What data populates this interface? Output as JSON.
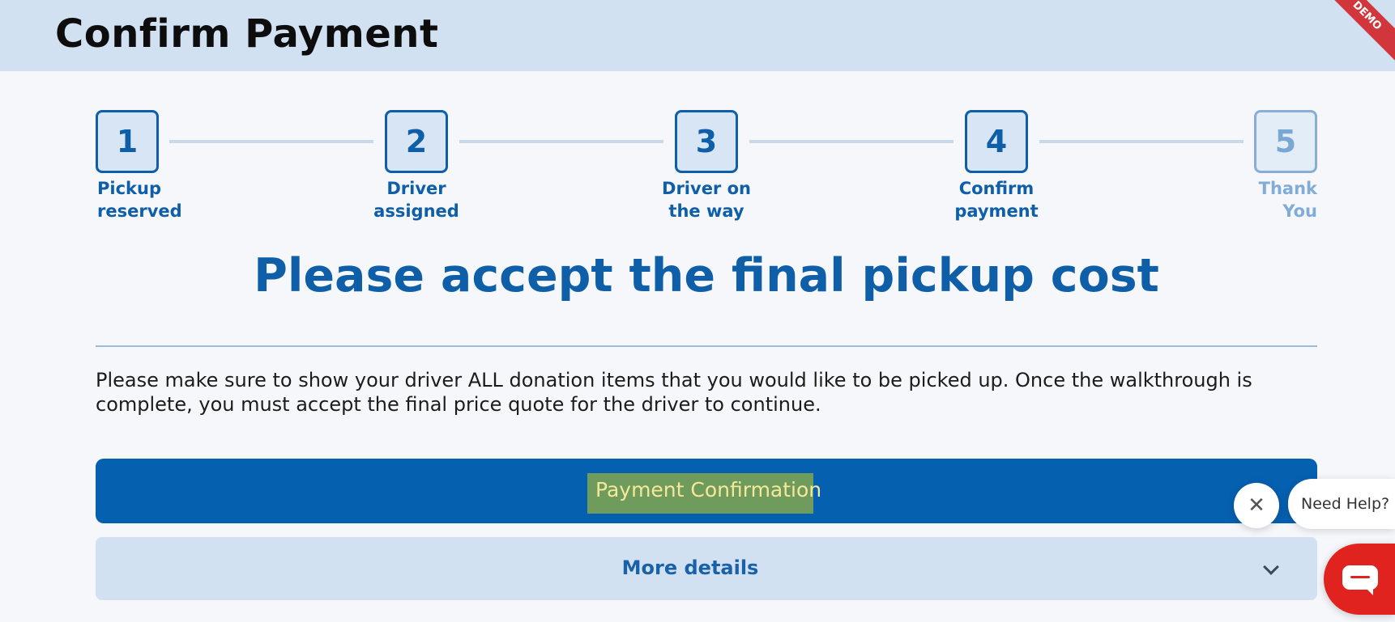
{
  "header": {
    "title": "Confirm Payment",
    "ribbon": "DEMO"
  },
  "stepper": {
    "steps": [
      {
        "number": "1",
        "label_line1": "Pickup",
        "label_line2": "reserved"
      },
      {
        "number": "2",
        "label_line1": "Driver",
        "label_line2": "assigned"
      },
      {
        "number": "3",
        "label_line1": "Driver on",
        "label_line2": "the way"
      },
      {
        "number": "4",
        "label_line1": "Confirm",
        "label_line2": "payment"
      },
      {
        "number": "5",
        "label_line1": "Thank",
        "label_line2": "You"
      }
    ]
  },
  "main": {
    "headline": "Please accept the final pickup cost",
    "instructions": "Please make sure to show your driver ALL donation items that you would like to be picked up. Once the walkthrough is complete, you must accept the final price quote for the driver to continue.",
    "pay_button_label": "Payment Confirmation",
    "more_details_label": "More details"
  },
  "chat": {
    "help_text": "Need Help?",
    "close_symbol": "✕",
    "icons": {
      "close": "close-icon",
      "chevron": "chevron-down-icon",
      "chat": "chat-icon"
    }
  },
  "colors": {
    "primary": "#0660b0",
    "header_bg": "#d1e1f2",
    "chat_red": "#e0231f",
    "highlight": "#6f9b5c"
  }
}
